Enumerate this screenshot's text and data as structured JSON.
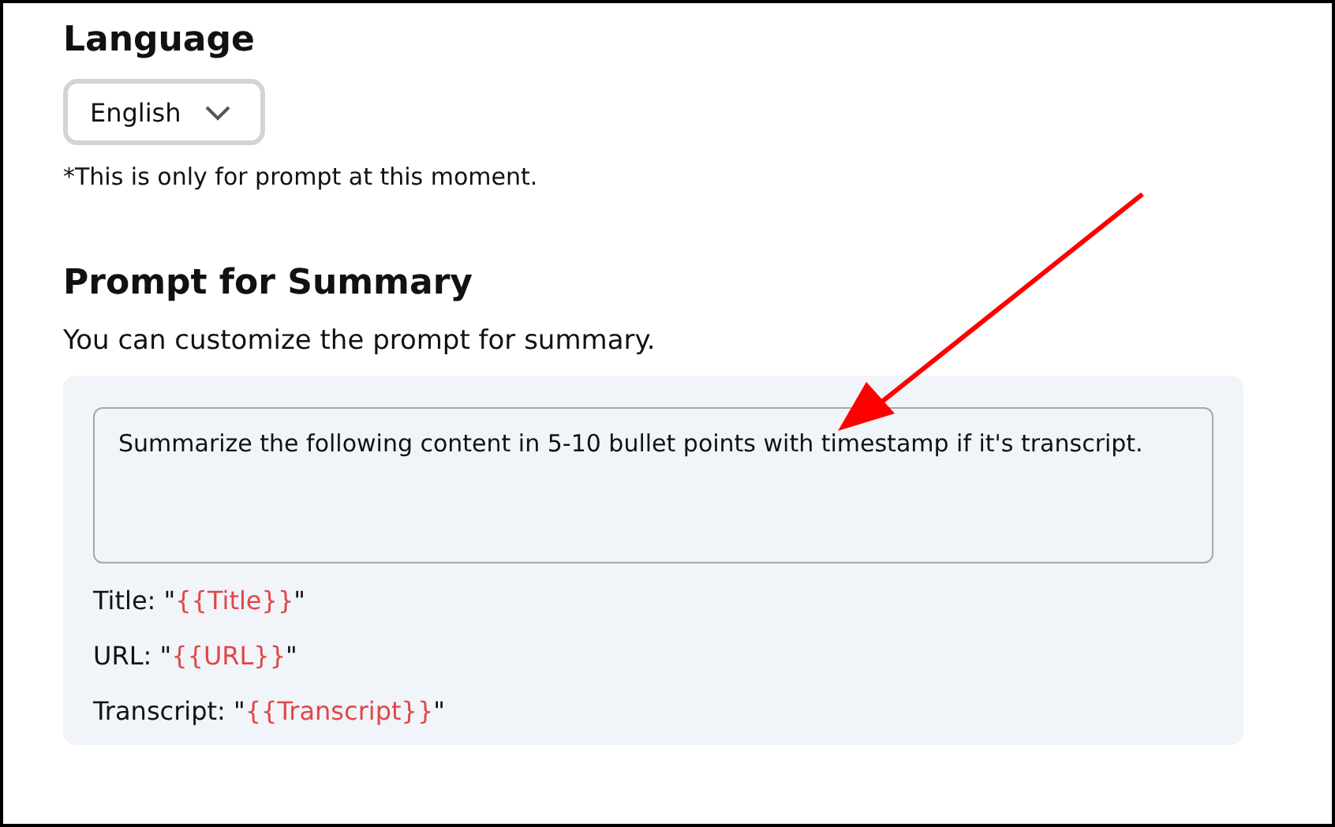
{
  "language": {
    "heading": "Language",
    "select": {
      "value": "English"
    },
    "note": "*This is only for prompt at this moment."
  },
  "prompt": {
    "heading": "Prompt for Summary",
    "description": "You can customize the prompt for summary.",
    "textarea": {
      "value": "Summarize the following content in 5-10 bullet points with timestamp if it's transcript."
    },
    "variables": [
      {
        "prefix": "Title: \"",
        "variable": "{{Title}}",
        "suffix": "\""
      },
      {
        "prefix": "URL: \"",
        "variable": "{{URL}}",
        "suffix": "\""
      },
      {
        "prefix": "Transcript: \"",
        "variable": "{{Transcript}}",
        "suffix": "\""
      }
    ]
  }
}
